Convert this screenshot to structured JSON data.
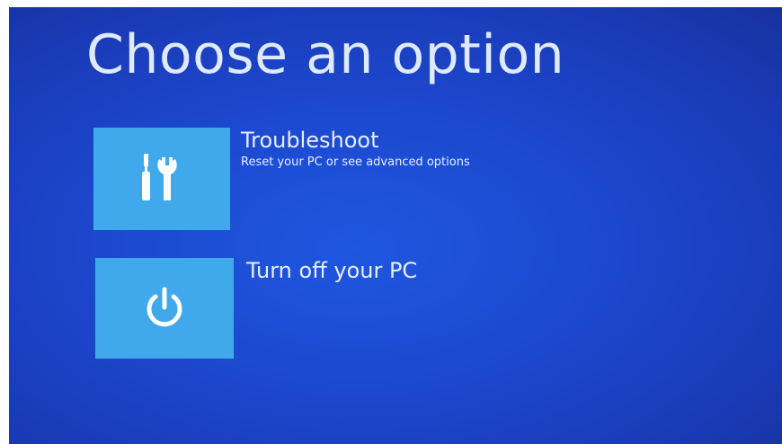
{
  "screen": {
    "title": "Choose an option",
    "background_color": "#1c49cf",
    "tile_color": "#3fa9ec"
  },
  "options": [
    {
      "label": "Troubleshoot",
      "description": "Reset your PC or see advanced options",
      "icon": "tools-icon"
    },
    {
      "label": "Turn off your PC",
      "description": "",
      "icon": "power-icon"
    }
  ]
}
